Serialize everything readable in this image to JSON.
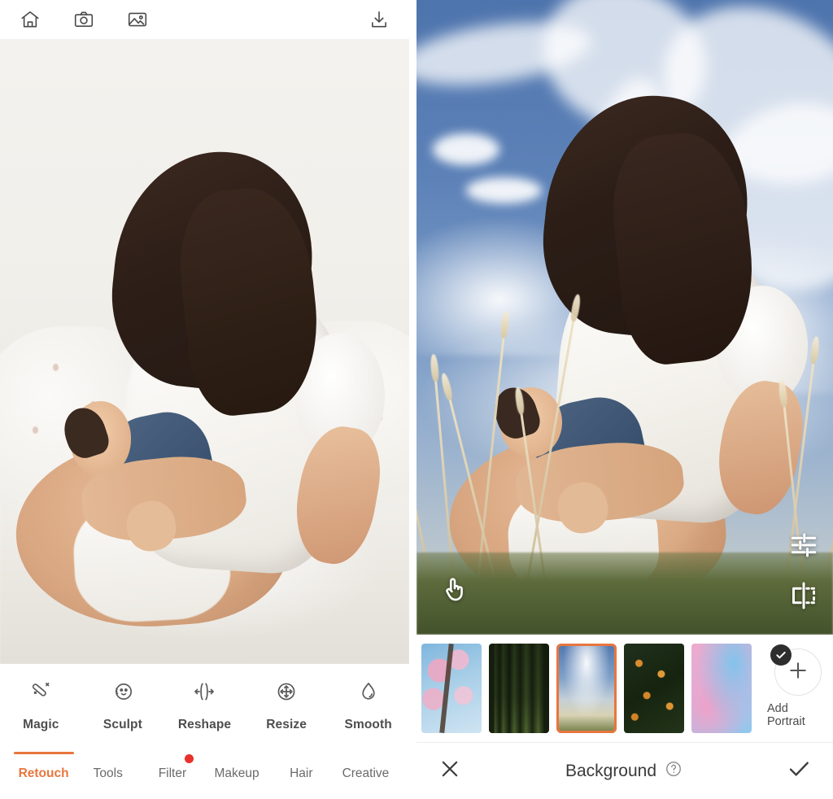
{
  "left_panel": {
    "topbar": {
      "home_icon": "home-icon",
      "camera_icon": "camera-icon",
      "gallery_icon": "gallery-image-icon",
      "download_icon": "download-save-icon"
    },
    "photo": {
      "caption": "Original photo: woman in white blouse holding a sleeping baby on a white bed indoors"
    },
    "tools": [
      {
        "label": "Magic",
        "icon": "magic-wand-icon"
      },
      {
        "label": "Sculpt",
        "icon": "face-sculpt-icon"
      },
      {
        "label": "Reshape",
        "icon": "reshape-arrows-icon"
      },
      {
        "label": "Resize",
        "icon": "resize-move-icon"
      },
      {
        "label": "Smooth",
        "icon": "water-droplet-icon"
      }
    ],
    "tabs": [
      {
        "label": "Retouch",
        "active": true,
        "badge": false
      },
      {
        "label": "Tools",
        "active": false,
        "badge": false
      },
      {
        "label": "Filter",
        "active": false,
        "badge": true
      },
      {
        "label": "Makeup",
        "active": false,
        "badge": false
      },
      {
        "label": "Hair",
        "active": false,
        "badge": false
      },
      {
        "label": "Creative",
        "active": false,
        "badge": false
      }
    ]
  },
  "right_panel": {
    "photo": {
      "caption": "Edited photo: same subject composited onto a blue sky with clouds and tall grass background"
    },
    "overlay_controls": [
      {
        "icon": "adjust-sliders-icon"
      },
      {
        "icon": "flip-mirror-icon"
      },
      {
        "icon": "tap-hand-gesture-icon"
      }
    ],
    "backgrounds": [
      {
        "name": "cherry-blossom",
        "selected": false
      },
      {
        "name": "forest",
        "selected": false
      },
      {
        "name": "sky-field",
        "selected": true
      },
      {
        "name": "dark-foliage",
        "selected": false
      },
      {
        "name": "pink-blue-watercolor",
        "selected": false
      }
    ],
    "add_portrait": {
      "label": "Add Portrait",
      "plus_icon": "plus-icon",
      "badge_icon": "check-badge-icon"
    },
    "actionbar": {
      "cancel_icon": "close-x-icon",
      "title": "Background",
      "help_icon": "help-question-icon",
      "confirm_icon": "check-confirm-icon"
    }
  },
  "colors": {
    "accent_orange": "#E8763E",
    "badge_red": "#E8312B",
    "text_dark": "#4a4a4a",
    "text_muted": "#6b6b6b",
    "panel_bg": "#ffffff"
  }
}
